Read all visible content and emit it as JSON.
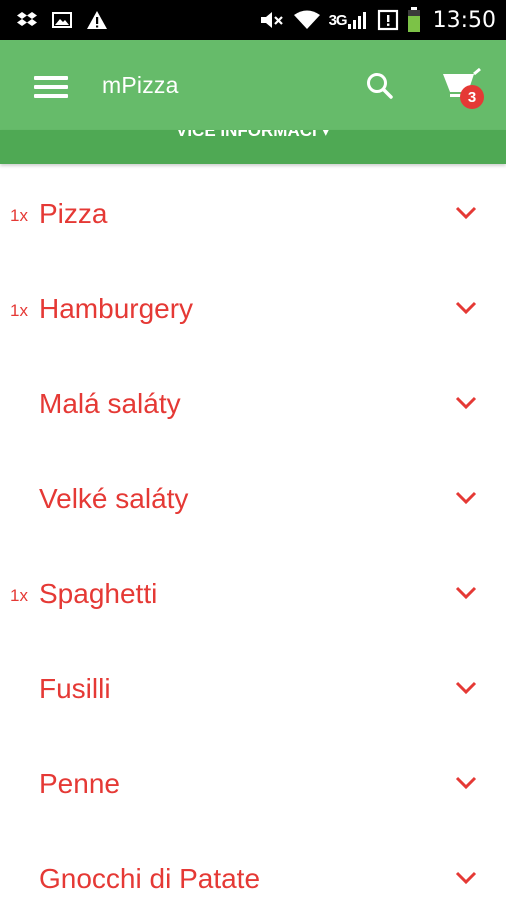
{
  "status_bar": {
    "left_icons": [
      "dropbox-icon",
      "image-icon",
      "warning-icon"
    ],
    "right_icons": [
      "mute-icon",
      "wifi-icon",
      "signal-icon",
      "sim-icon",
      "battery-icon"
    ],
    "network": "3G",
    "time": "13:50"
  },
  "app_bar": {
    "title": "mPizza",
    "cart_count": "3",
    "background": "#66bb6a",
    "badge_color": "#e53935"
  },
  "info_strip": {
    "label": "VÍCE INFORMACÍ ▾"
  },
  "categories": [
    {
      "count": "1x",
      "name": "Pizza"
    },
    {
      "count": "1x",
      "name": "Hamburgery"
    },
    {
      "count": "",
      "name": "Malá saláty"
    },
    {
      "count": "",
      "name": "Velké saláty"
    },
    {
      "count": "1x",
      "name": "Spaghetti"
    },
    {
      "count": "",
      "name": "Fusilli"
    },
    {
      "count": "",
      "name": "Penne"
    },
    {
      "count": "",
      "name": "Gnocchi di Patate"
    }
  ],
  "accent_color": "#e53935"
}
